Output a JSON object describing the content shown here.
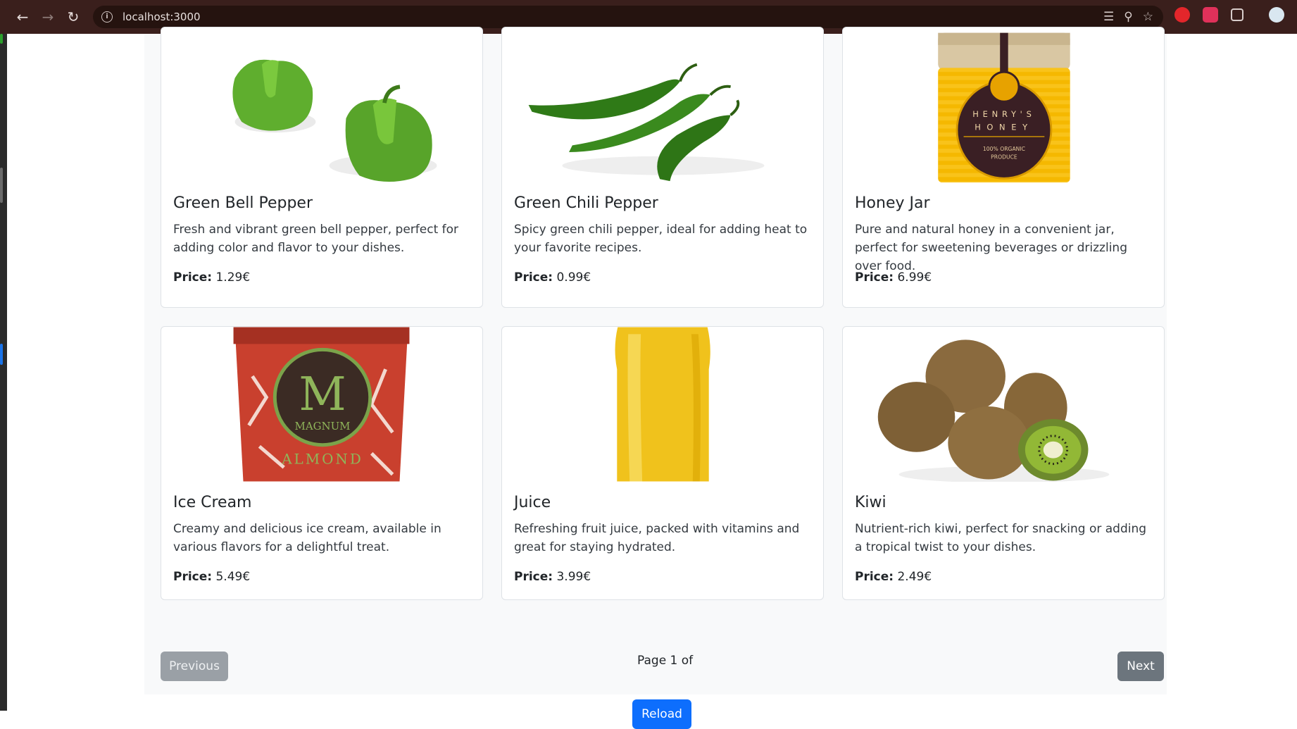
{
  "browser": {
    "url": "localhost:3000",
    "nav": {
      "back_icon": "back-arrow-icon",
      "forward_icon": "forward-arrow-icon",
      "reload_icon": "reload-icon"
    }
  },
  "products": [
    {
      "name": "Green Bell Pepper",
      "description": "Fresh and vibrant green bell pepper, perfect for adding color and flavor to your dishes.",
      "price_label": "Price:",
      "price": "1.29€",
      "image": "green-bell-pepper"
    },
    {
      "name": "Green Chili Pepper",
      "description": "Spicy green chili pepper, ideal for adding heat to your favorite recipes.",
      "price_label": "Price:",
      "price": "0.99€",
      "image": "green-chili-pepper"
    },
    {
      "name": "Honey Jar",
      "description": "Pure and natural honey in a convenient jar, perfect for sweetening beverages or drizzling over food.",
      "price_label": "Price:",
      "price": "6.99€",
      "image": "honey-jar",
      "image_text": [
        "HENRY'S",
        "HONEY",
        "100% ORGANIC",
        "PRODUCE"
      ]
    },
    {
      "name": "Ice Cream",
      "description": "Creamy and delicious ice cream, available in various flavors for a delightful treat.",
      "price_label": "Price:",
      "price": "5.49€",
      "image": "ice-cream",
      "image_text": [
        "M",
        "MAGNUM",
        "ALMOND"
      ]
    },
    {
      "name": "Juice",
      "description": "Refreshing fruit juice, packed with vitamins and great for staying hydrated.",
      "price_label": "Price:",
      "price": "3.99€",
      "image": "juice"
    },
    {
      "name": "Kiwi",
      "description": "Nutrient-rich kiwi, perfect for snacking or adding a tropical twist to your dishes.",
      "price_label": "Price:",
      "price": "2.49€",
      "image": "kiwi"
    }
  ],
  "pagination": {
    "previous_label": "Previous",
    "next_label": "Next",
    "page_text": "Page 1 of"
  },
  "reload_label": "Reload"
}
